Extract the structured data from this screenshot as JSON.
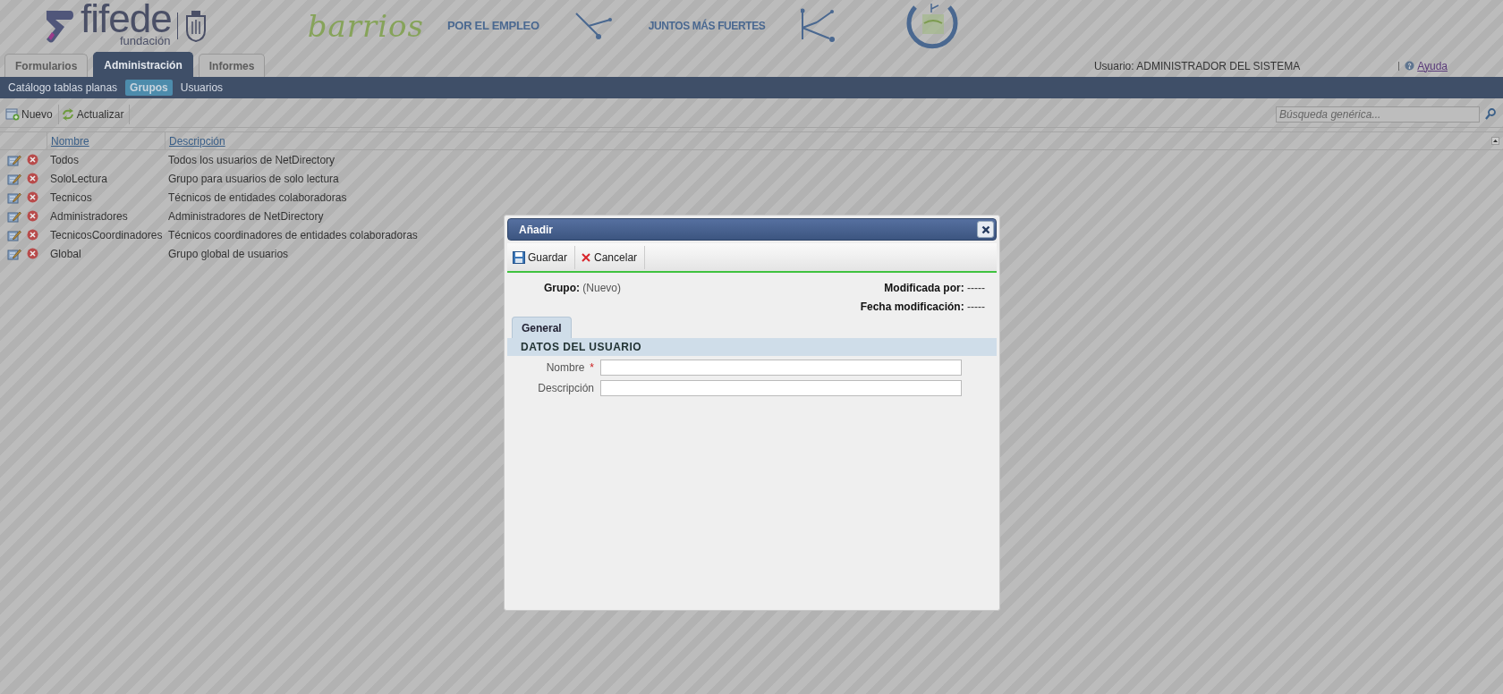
{
  "header": {
    "brand": "fifede",
    "brand_sub": "fundación",
    "campaign": "barrios",
    "campaign_tagline": "POR EL EMPLEO",
    "slogan": "JUNTOS MÁS FUERTES"
  },
  "tabs": [
    {
      "label": "Formularios",
      "selected": false
    },
    {
      "label": "Administración",
      "selected": true
    },
    {
      "label": "Informes",
      "selected": false
    }
  ],
  "user": "Usuario: ADMINISTRADOR DEL SISTEMA",
  "help": "Ayuda",
  "subnav": [
    {
      "label": "Catálogo tablas planas",
      "selected": false
    },
    {
      "label": "Grupos",
      "selected": true
    },
    {
      "label": "Usuarios",
      "selected": false
    }
  ],
  "toolbar": {
    "buttons": [
      {
        "kind": "new",
        "label": "Nuevo"
      },
      {
        "kind": "refresh",
        "label": "Actualizar"
      }
    ],
    "search": {
      "placeholder": "Búsqueda genérica..."
    }
  },
  "table": {
    "columns": [
      "Nombre",
      "Descripción"
    ],
    "rows": [
      {
        "name": "Todos",
        "description": "Todos los usuarios de NetDirectory"
      },
      {
        "name": "SoloLectura",
        "description": "Grupo para usuarios de solo lectura"
      },
      {
        "name": "Tecnicos",
        "description": "Técnicos de entidades colaboradoras"
      },
      {
        "name": "Administradores",
        "description": "Administradores de NetDirectory"
      },
      {
        "name": "TecnicosCoordinadores",
        "description": "Técnicos coordinadores de entidades colaboradoras"
      },
      {
        "name": "Global",
        "description": "Grupo global de usuarios"
      }
    ]
  },
  "dialog": {
    "title": "Añadir",
    "buttons": [
      {
        "kind": "save",
        "label": "Guardar"
      },
      {
        "kind": "cancel",
        "label": "Cancelar"
      }
    ],
    "group_label": "Grupo:",
    "group_value": "(Nuevo)",
    "meta": [
      "**Modificada por:** -----",
      "**Fecha modificación:** -----"
    ],
    "tabs": [
      {
        "label": "General",
        "selected": true
      }
    ],
    "section": "DATOS DEL USUARIO",
    "fields": [
      {
        "label": "Nombre",
        "required_mark": "*"
      },
      {
        "label": "Descripción"
      }
    ]
  }
}
